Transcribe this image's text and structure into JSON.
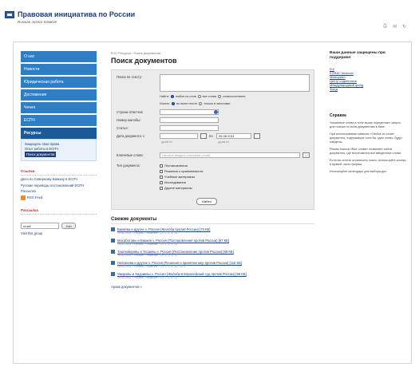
{
  "header": {
    "title": "Правовая инициатива по России",
    "subtitle": "Russian Justice Initiative",
    "icons": [
      "print-icon",
      "email-icon",
      "share-icon"
    ]
  },
  "nav": {
    "items": [
      {
        "label": "О нас"
      },
      {
        "label": "Новости"
      },
      {
        "label": "Юридическая работа"
      },
      {
        "label": "Достижения"
      },
      {
        "label": "Чечня"
      },
      {
        "label": "ЕСПЧ"
      },
      {
        "label": "Ресурсы"
      }
    ],
    "sub": [
      "Защищать свои права",
      "Опыт работы в ЕСПЧ",
      "Поиск документов"
    ]
  },
  "links": {
    "title": "Ссылки",
    "items": [
      "Дело по Северному Кавказу в ЕСПЧ",
      "Русские переводы постановлений ЕСПЧ",
      "Рассылка"
    ],
    "rss": "RSS Feed"
  },
  "subscribe": {
    "title": "Рассылка",
    "email": "email",
    "join": "Join",
    "visit": "Visit this group"
  },
  "breadcrumb": "RJI / Ресурсы / Поиск документов",
  "page_title": "Поиск документов",
  "form": {
    "text_label": "Поиск по тексту:",
    "find_label": "Найти:",
    "find_opts": [
      "любое из слов",
      "все слова",
      "словосочетание"
    ],
    "search_label": "Искать:",
    "search_opts": [
      "во всем тексте",
      "только в заголовке"
    ],
    "fields": [
      "Страна-ответчик:",
      "Номер жалобы:",
      "Статья:",
      "Дата документа: с"
    ],
    "date_to": "по",
    "date_to_value": "05.08.2011",
    "date_hint": "дд.мм.гггг",
    "kw_label": "Ключевые слова:",
    "kw_placeholder": "Начните вводить ключевые слова",
    "kw_btn": "...",
    "type_label": "Тип документа:",
    "types": [
      "Постановления",
      "Решения о приемлемости",
      "Учебные материалы",
      "Исследования",
      "Другие материалы"
    ],
    "submit": "Найти"
  },
  "docs": {
    "title": "Свежие документы",
    "items": [
      {
        "title": "Бакаева и другие v. Россия (Жалоба против России) [70 КБ]",
        "meta": "15.02.2011 / Россия / Решение / Ст. 2, 3, 5, 13"
      },
      {
        "title": "Масаботовы и Бакаев v. Россия (Постановление против России) [87 КБ]",
        "meta": "15.02.2011 / Россия / Решение / Ст. 2, 3, 5, 13"
      },
      {
        "title": "Таштемировы и Тесаевы v. Россия (Постановление против России) [89 КБ]",
        "meta": "15.02.2011 / Россия / Решение / Ст. 2, 3, 5, 13"
      },
      {
        "title": "Гайсанова и другие v. Россия (Решения о принятии мер против России) [115 КБ]",
        "meta": "15.02.2011 / Россия / Решение / Ст. 2, 3, 5, 13, П1-1"
      },
      {
        "title": "Умаровы и Хадзиевы v. Россия (Жалоба в Европейский суд против России) [96 КБ]",
        "meta": "15.02.2011 / Россия / Решение / Ст. 2, 3, 5, 13"
      }
    ],
    "all": "Архив документов »"
  },
  "right": {
    "title": "Ваши данные защищены при поддержке:",
    "links": [
      "RJI",
      "EHRAC Moscow",
      "Мемориал",
      "Центр содействия",
      "Международный фонд",
      "Фонд"
    ],
    "help_title": "Справка",
    "paras": [
      "Указанные слова в поле выше определяют запрос для поиска по всем документам в базе.",
      "При использовании кавычек «Любое из слов» документы, содержащие хотя бы одно слово, будут найдены.",
      "Режим поиска «Все слова» позволяет найти документы, где встречаются все введенные слова.",
      "Если вы хотите ограничить поиск, используйте кнопку в правой части формы.",
      "Используйте календарь для выбора дат."
    ]
  }
}
